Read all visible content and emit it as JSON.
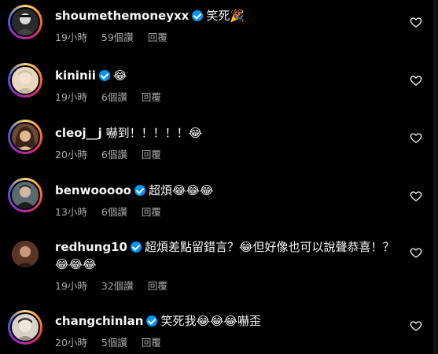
{
  "comments": [
    {
      "username": "shoumethemoneyxx",
      "verified": true,
      "text": "笑死🎉",
      "time": "19小時",
      "likes": "59個讚",
      "reply": "回覆",
      "avatar_color": "#2a2a2a",
      "ring": true
    },
    {
      "username": "kininii",
      "verified": true,
      "text": "😂",
      "time": "19小時",
      "likes": "6個讚",
      "reply": "回覆",
      "avatar_color": "#e8d8c0",
      "ring": true
    },
    {
      "username": "cleoj__j",
      "verified": false,
      "text": "嚇到！！！！！😂",
      "time": "20小時",
      "likes": "6個讚",
      "reply": "回覆",
      "avatar_color": "#6b4a35",
      "ring": true
    },
    {
      "username": "benwooooo",
      "verified": true,
      "text": "超煩😂😂😂",
      "time": "13小時",
      "likes": "6個讚",
      "reply": "回覆",
      "avatar_color": "#5b6a6f",
      "ring": true
    },
    {
      "username": "redhung10",
      "verified": true,
      "text": "超煩差點留錯言？😂但好像也可以說聲恭喜！？",
      "text2": "😂😂😂",
      "time": "19小時",
      "likes": "32個讚",
      "reply": "回覆",
      "avatar_color": "#7a4b3a",
      "ring": false
    },
    {
      "username": "changchinlan",
      "verified": true,
      "text": "笑死我😂😂😂嚇歪",
      "time": "20小時",
      "likes": "5個讚",
      "reply": "回覆",
      "avatar_color": "#d8d2c8",
      "ring": true
    }
  ],
  "icons": {
    "like": "heart-outline-icon",
    "verified": "verified-badge-icon"
  },
  "colors": {
    "background": "#000000",
    "text": "#f5f5f5",
    "meta": "#a8a8a8",
    "verified": "#0095f6"
  }
}
